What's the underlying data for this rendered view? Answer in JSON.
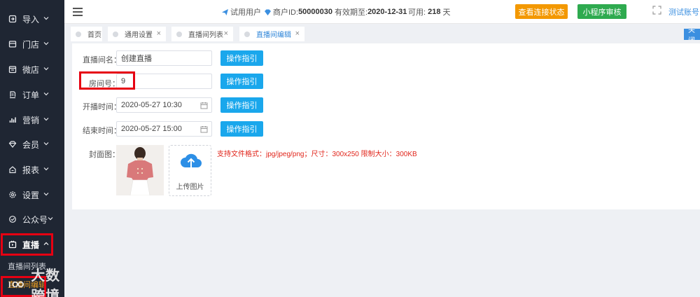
{
  "sidebar": {
    "items": [
      {
        "label": "导入",
        "icon": "import-icon"
      },
      {
        "label": "门店",
        "icon": "store-icon"
      },
      {
        "label": "微店",
        "icon": "microstore-icon"
      },
      {
        "label": "订单",
        "icon": "order-icon"
      },
      {
        "label": "营销",
        "icon": "chart-icon"
      },
      {
        "label": "会员",
        "icon": "diamond-icon"
      },
      {
        "label": "报表",
        "icon": "report-icon"
      },
      {
        "label": "设置",
        "icon": "gear-icon"
      },
      {
        "label": "公众号",
        "icon": "wechat-icon"
      },
      {
        "label": "直播",
        "icon": "live-icon"
      }
    ],
    "sub_items": [
      {
        "label": "直播间列表"
      },
      {
        "label": "直播间编辑"
      }
    ]
  },
  "topbar": {
    "user_type": "试用用户",
    "merchant_label": "商户ID:",
    "merchant_id": "50000030",
    "expiry_label": "有效期至:",
    "expiry_date": "2020-12-31",
    "available_label": "可用:",
    "available_days": "218",
    "days_unit": "天",
    "check_connection": "查看连接状态",
    "miniprogram_review": "小程序审核",
    "account": "测试账号"
  },
  "tabs": [
    {
      "label": "首页",
      "closable": false
    },
    {
      "label": "通用设置",
      "closable": true
    },
    {
      "label": "直播间列表",
      "closable": true
    },
    {
      "label": "直播间编辑",
      "closable": true,
      "active": true
    }
  ],
  "close_label": "关闭",
  "form": {
    "room_name_label": "直播间名：",
    "room_name_value": "创建直播",
    "room_no_label": "房间号：",
    "room_no_value": "9",
    "start_label": "开播时间：",
    "start_value": "2020-05-27 10:30",
    "end_label": "结束时间：",
    "end_value": "2020-05-27 15:00",
    "cover_label": "封面图：",
    "guide_button": "操作指引",
    "upload_label": "上传图片",
    "upload_hint": "支持文件格式：jpg/jpeg/png；尺寸：300x250 限制大小：300KB"
  },
  "watermark": "大数跨境",
  "colors": {
    "sidebar_bg": "#1f2633",
    "highlight": "#e60012",
    "primary_blue": "#1aa7ec",
    "orange": "#f39800",
    "green": "#2eaa4f",
    "hint_red": "#e1251b"
  }
}
